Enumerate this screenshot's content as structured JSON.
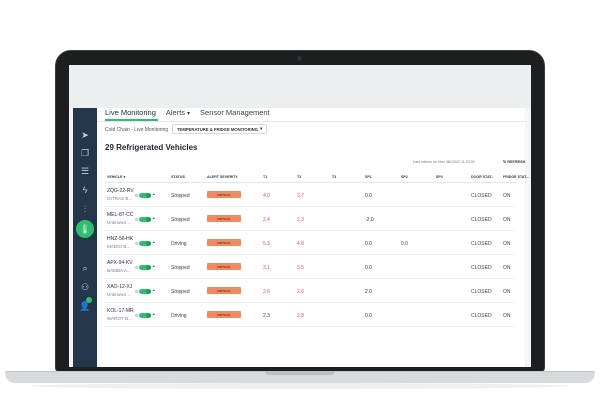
{
  "tabs": [
    {
      "label": "Live Monitoring"
    },
    {
      "label": "Alerts",
      "caret": "▾"
    },
    {
      "label": "Sensor Management"
    }
  ],
  "breadcrumb": "Cold Chain - Live Monitoring",
  "filter": {
    "label": "TEMPERATURE & FRIDGE MONITORING",
    "caret": "▾"
  },
  "title": "29 Refrigerated Vehicles",
  "refresh": {
    "info": "Last refresh on Mon 06/13/22 11:23:39",
    "label": "REFRESH",
    "icon": "↻"
  },
  "sidebar": {
    "icons": [
      "navigation-icon",
      "vehicles-icon",
      "list-icon",
      "bolt-icon",
      "sliders-icon",
      "thermometer-icon",
      "search-icon",
      "network-icon",
      "user-icon"
    ],
    "glyphs": [
      "➤",
      "❐",
      "☰",
      "ϟ",
      "⫶",
      "🌡",
      "⌕",
      "⚇",
      "👤"
    ]
  },
  "columns": {
    "vehicle": "VEHICLE",
    "sort": "▾",
    "status": "STATUS",
    "severity": "ALERT SEVERITY",
    "t1": "T1",
    "t2": "T2",
    "t3": "T3",
    "sp1": "SP1",
    "sp2": "SP2",
    "sp3": "SP3",
    "door": "DOOR STAT...",
    "fridge": "FRIDGE STAT..."
  },
  "rows": [
    {
      "plate": "ZQG-22-RV",
      "owner": "GITRAS B...",
      "status": "Stopped",
      "severity": "CRITICAL",
      "t1": "4.0",
      "t2": "3.7",
      "t3": "",
      "sp1": "0.0",
      "sp2": "",
      "sp3": "",
      "door": "CLOSED",
      "fridge": "ON"
    },
    {
      "plate": "MEL-87-CC",
      "owner": "Unknown ...",
      "status": "Stopped",
      "severity": "CRITICAL",
      "t1": "2.4",
      "t2": "2.3",
      "t3": "",
      "sp1": "-2.0",
      "sp2": "",
      "sp3": "",
      "door": "CLOSED",
      "fridge": "ON"
    },
    {
      "plate": "HNZ-56-HK",
      "owner": "MADIO B...",
      "status": "Driving",
      "severity": "CRITICAL",
      "t1": "5.3",
      "t2": "4.8",
      "t3": "",
      "sp1": "0.0",
      "sp2": "0.0",
      "sp3": "",
      "door": "CLOSED",
      "fridge": "ON"
    },
    {
      "plate": "APX-94-KV",
      "owner": "BAMBA A...",
      "status": "Stopped",
      "severity": "CRITICAL",
      "t1": "3.1",
      "t2": "3.5",
      "t3": "",
      "sp1": "0.0",
      "sp2": "",
      "sp3": "",
      "door": "CLOSED",
      "fridge": "ON"
    },
    {
      "plate": "XAO-12-XJ",
      "owner": "Unknown ...",
      "status": "Stopped",
      "severity": "CRITICAL",
      "t1": "2.6",
      "t2": "2.6",
      "t3": "",
      "sp1": "2.0",
      "sp2": "",
      "sp3": "",
      "door": "CLOSED",
      "fridge": "ON"
    },
    {
      "plate": "KOL-17-MR",
      "owner": "WAROT B...",
      "status": "Driving",
      "severity": "CRITICAL",
      "t1": "2.3",
      "t2": "2.8",
      "t3": "",
      "sp1": "0.0",
      "sp2": "",
      "sp3": "",
      "door": "CLOSED",
      "fridge": "ON"
    }
  ],
  "colors": {
    "accent": "#2fbf71",
    "sidebar": "#24364a",
    "critical": "#f08a62",
    "temp_red": "#e2554a"
  }
}
